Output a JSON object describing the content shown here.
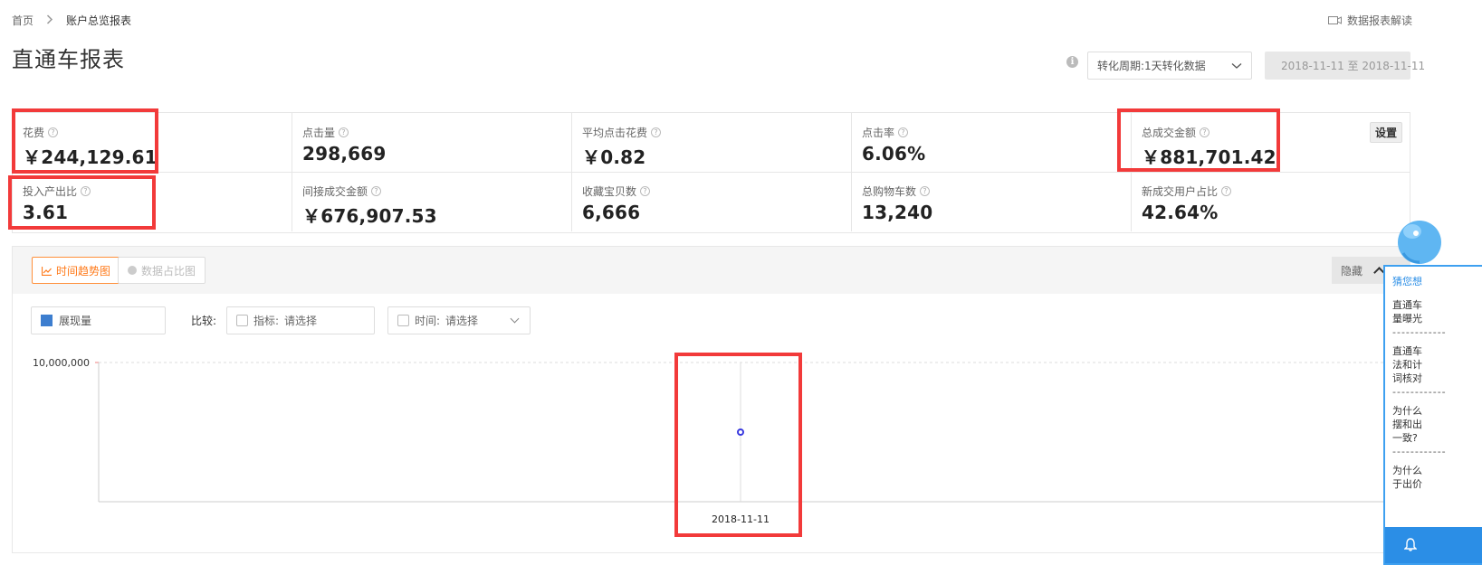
{
  "breadcrumb": {
    "home": "首页",
    "separator": ">",
    "current": "账户总览报表"
  },
  "report_help": {
    "label": "数据报表解读",
    "icon": "video-icon"
  },
  "page_title": "直通车报表",
  "filters": {
    "info_icon": "i",
    "cycle_select": "转化周期:1天转化数据",
    "date_range": "2018-11-11 至 2018-11-11"
  },
  "metrics": {
    "row1": [
      {
        "label": "花费",
        "value": "￥244,129.61"
      },
      {
        "label": "点击量",
        "value": "298,669"
      },
      {
        "label": "平均点击花费",
        "value": "￥0.82"
      },
      {
        "label": "点击率",
        "value": "6.06%"
      },
      {
        "label": "总成交金额",
        "value": "￥881,701.42"
      }
    ],
    "row2": [
      {
        "label": "投入产出比",
        "value": "3.61"
      },
      {
        "label": "间接成交金额",
        "value": "￥676,907.53"
      },
      {
        "label": "收藏宝贝数",
        "value": "6,666"
      },
      {
        "label": "总购物车数",
        "value": "13,240"
      },
      {
        "label": "新成交用户占比",
        "value": "42.64%"
      }
    ],
    "setting_label": "设置",
    "help_glyph": "?"
  },
  "chart_panel": {
    "tabs": {
      "trend": "时间趋势图",
      "share": "数据占比图"
    },
    "hide_label": "隐藏",
    "legend_label": "展现量",
    "compare_label": "比较:",
    "indicator_label": "指标:",
    "indicator_placeholder": "请选择",
    "time_label": "时间:",
    "time_placeholder": "请选择"
  },
  "chart_data": {
    "type": "line",
    "x": [
      "2018-11-11"
    ],
    "series": [
      {
        "name": "展现量",
        "values": [
          5000000
        ]
      }
    ],
    "y_tick_labels": [
      "10,000,000"
    ],
    "ylim": [
      0,
      10000000
    ],
    "grid": true,
    "colors": {
      "point": "#3a3adf",
      "legend": "#3d7ecf"
    }
  },
  "side_widget": {
    "title": "猜您想",
    "questions": [
      "直通车\n量曝光",
      "直通车\n法和计\n词核对",
      "为什么\n摆和出\n一致?",
      "为什么\n于出价"
    ],
    "divider": "------------",
    "accent_color": "#2b8ee6"
  },
  "highlight_color": "#f23a3a"
}
